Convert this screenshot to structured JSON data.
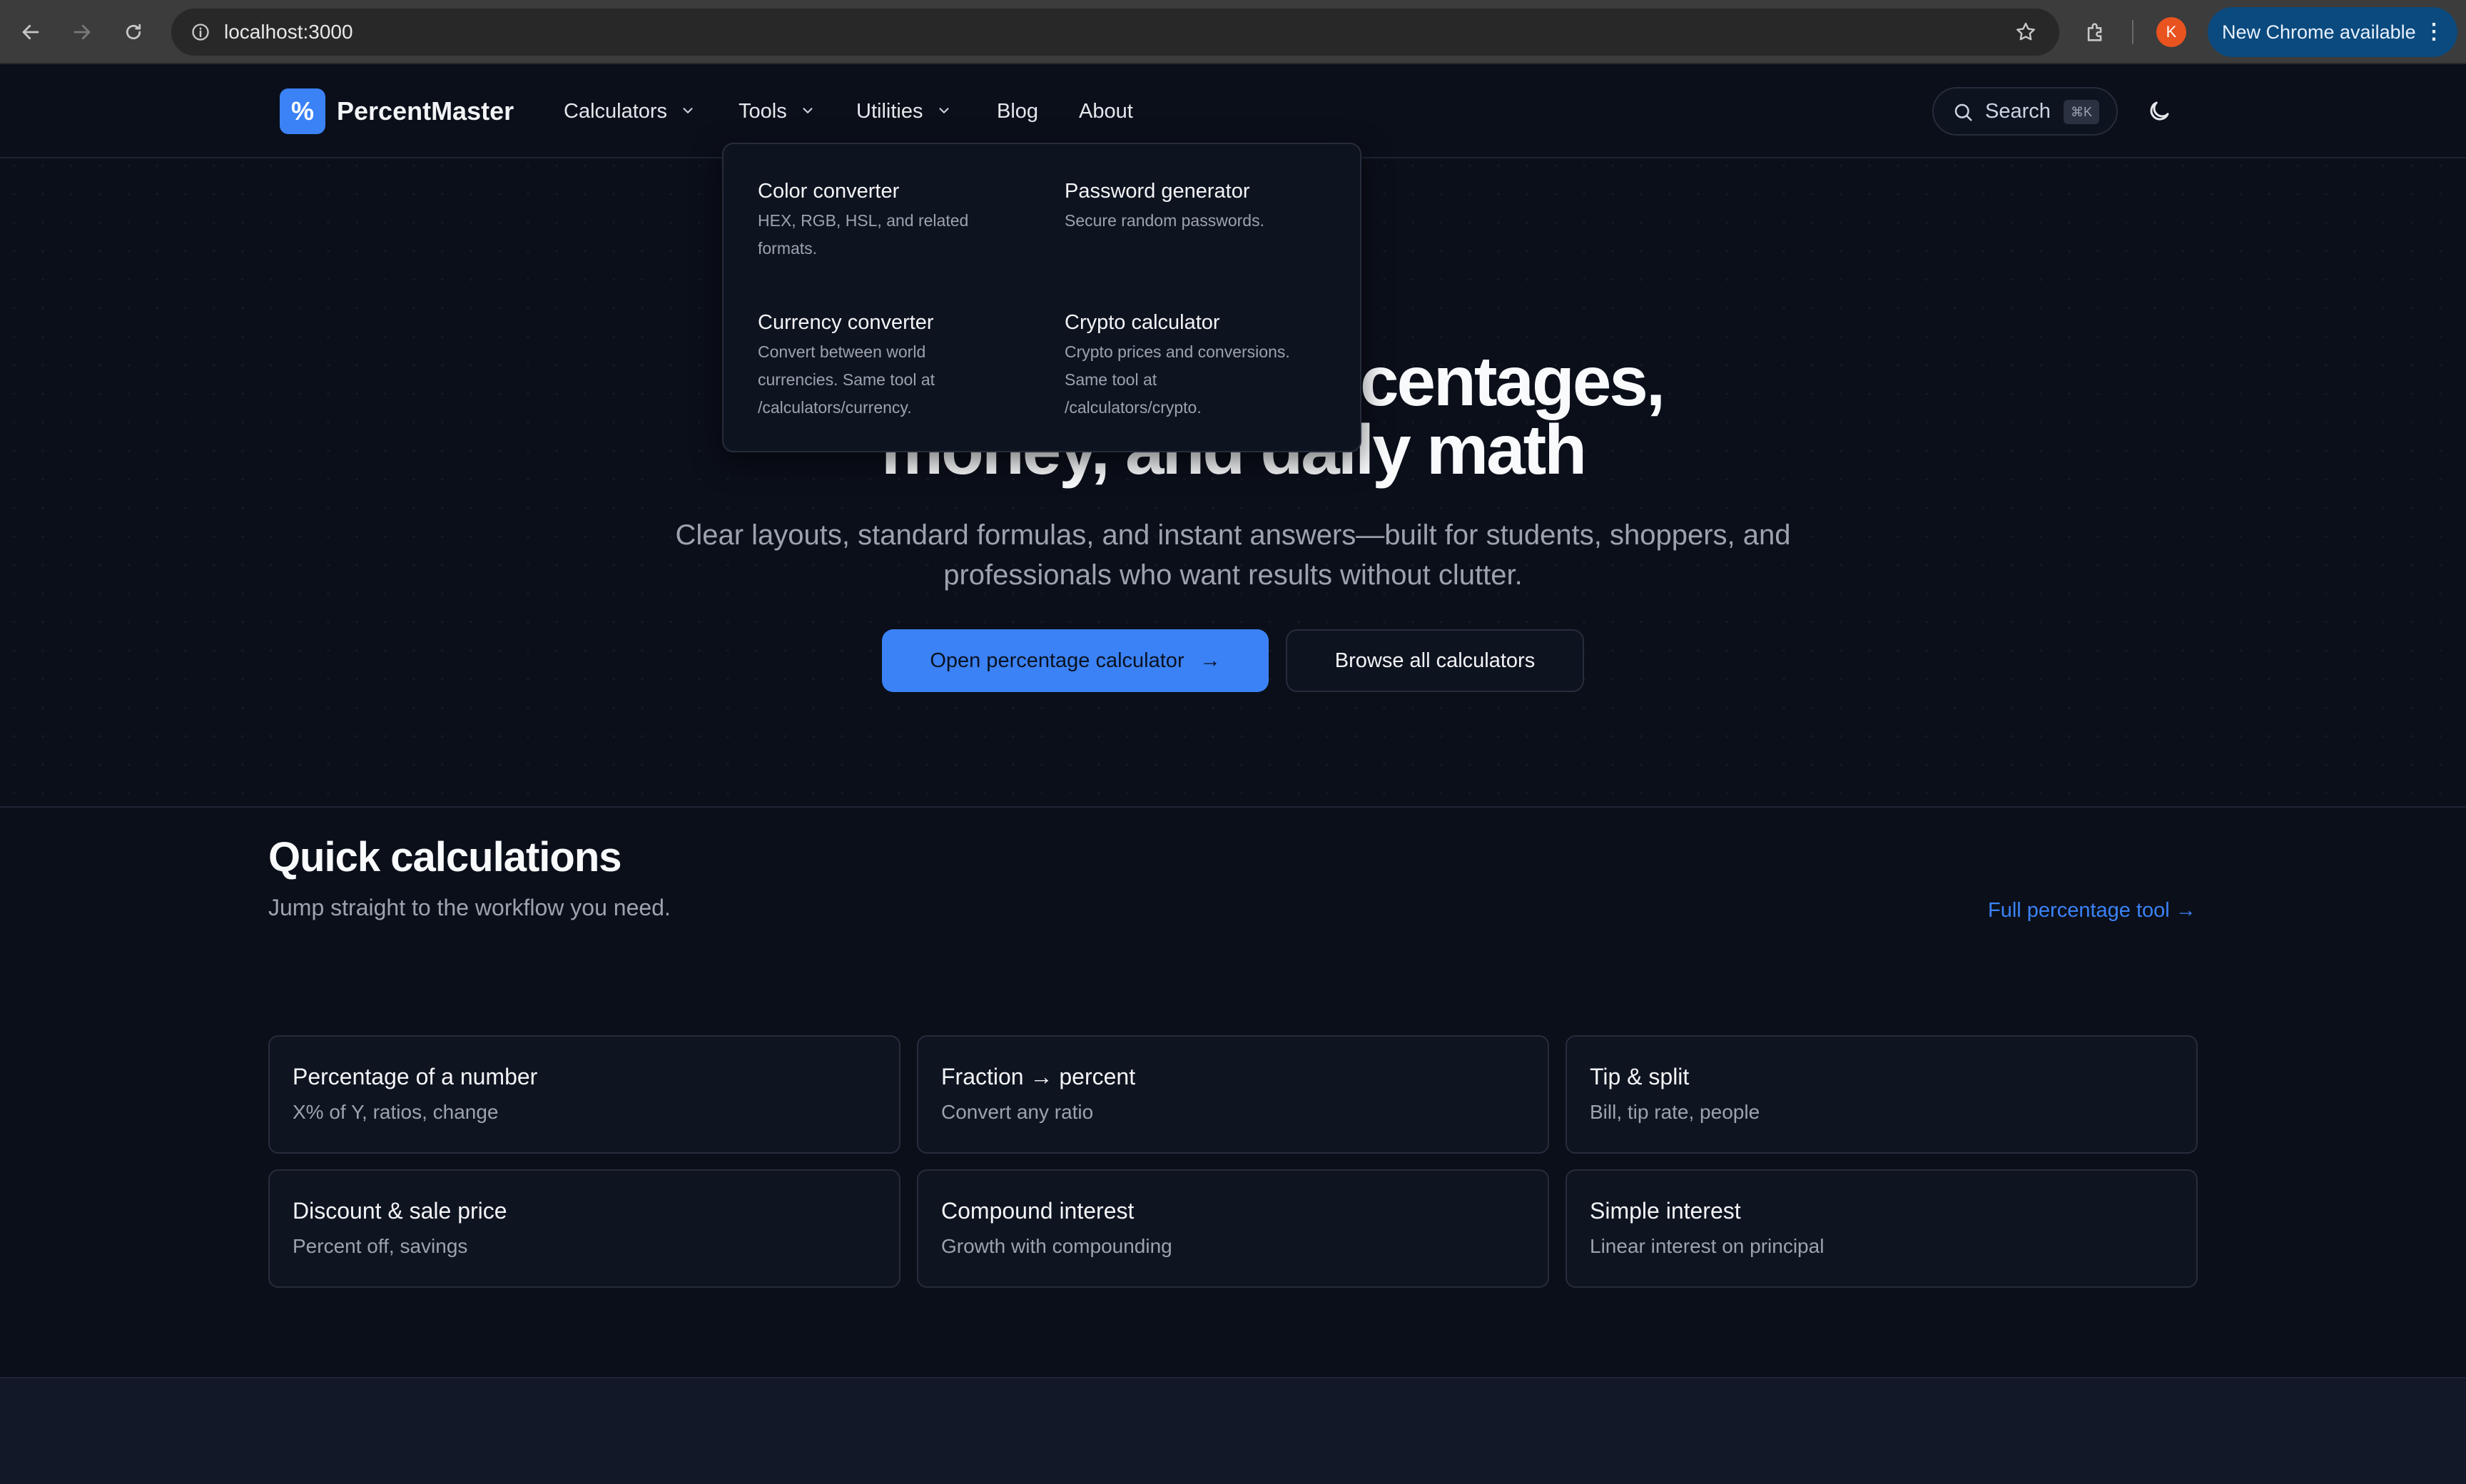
{
  "browser": {
    "url": "localhost:3000",
    "profile_initial": "K",
    "update_label": "New Chrome available",
    "update_menu_glyph": "⋮"
  },
  "nav": {
    "logo_glyph": "%",
    "logo_text": "PercentMaster",
    "items": [
      {
        "label": "Calculators"
      },
      {
        "label": "Tools"
      },
      {
        "label": "Utilities"
      },
      {
        "label": "Blog"
      },
      {
        "label": "About"
      }
    ],
    "search_label": "Search",
    "search_shortcut": "⌘K"
  },
  "dropdown": {
    "items": [
      {
        "title": "Color converter",
        "desc_lines": [
          "HEX, RGB, HSL, and related",
          "formats."
        ]
      },
      {
        "title": "Password generator",
        "desc_lines": [
          "Secure random passwords."
        ]
      },
      {
        "title": "Currency converter",
        "desc_lines": [
          "Convert between world",
          "currencies. Same tool at",
          "/calculators/currency."
        ]
      },
      {
        "title": "Crypto calculator",
        "desc_lines": [
          "Crypto prices and conversions.",
          "Same tool at",
          "/calculators/crypto."
        ]
      }
    ]
  },
  "hero": {
    "title_line1_visible": "centages,",
    "title_line2_visible": "money, and daily math",
    "subtitle_line1": "Clear layouts, standard formulas, and instant answers—built for students, shoppers, and",
    "subtitle_line2": "professionals who want results without clutter.",
    "primary_button": "Open percentage calculator",
    "primary_arrow": "→",
    "secondary_button": "Browse all calculators"
  },
  "quick": {
    "title": "Quick calculations",
    "subtitle": "Jump straight to the workflow you need.",
    "link": "Full percentage tool →",
    "cards": [
      {
        "title": "Percentage of a number",
        "desc": "X% of Y, ratios, change"
      },
      {
        "title": "Fraction → percent",
        "desc": "Convert any ratio"
      },
      {
        "title": "Tip & split",
        "desc": "Bill, tip rate, people"
      },
      {
        "title": "Discount & sale price",
        "desc": "Percent off, savings"
      },
      {
        "title": "Compound interest",
        "desc": "Growth with compounding"
      },
      {
        "title": "Simple interest",
        "desc": "Linear interest on principal"
      }
    ]
  },
  "colors": {
    "accent": "#3b82f6",
    "background": "#0b0f1a",
    "card_border": "#262c3b"
  }
}
